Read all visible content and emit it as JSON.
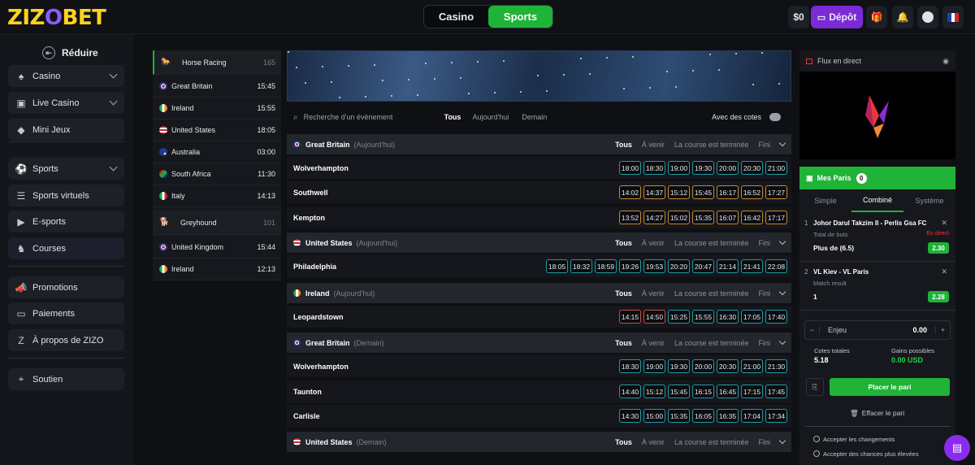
{
  "brand": {
    "logo_left": "ZIZ",
    "logo_mid": "O",
    "logo_right": "BET"
  },
  "topbar": {
    "casino": "Casino",
    "sports": "Sports",
    "balance": "$0",
    "depot": "Dépôt"
  },
  "sidebar": {
    "collapse": "Réduire",
    "items": [
      {
        "label": "Casino",
        "icon": "cards-icon"
      },
      {
        "label": "Live Casino",
        "icon": "live-icon"
      },
      {
        "label": "Mini Jeux",
        "icon": "gem-icon"
      },
      {
        "label": "Sports",
        "icon": "soccer-icon"
      },
      {
        "label": "Sports virtuels",
        "icon": "virtual-icon"
      },
      {
        "label": "E-sports",
        "icon": "play-icon"
      },
      {
        "label": "Courses",
        "icon": "horse-icon"
      },
      {
        "label": "Promotions",
        "icon": "megaphone-icon"
      },
      {
        "label": "Paiements",
        "icon": "wallet-icon"
      },
      {
        "label": "À propos de ZIZO",
        "icon": "z-icon"
      },
      {
        "label": "Soutien",
        "icon": "support-icon"
      }
    ]
  },
  "races": {
    "horse": {
      "label": "Horse Racing",
      "count": "165"
    },
    "horse_items": [
      {
        "name": "Great Britain",
        "time": "15:45",
        "flag": "gb"
      },
      {
        "name": "Ireland",
        "time": "15:55",
        "flag": "ie"
      },
      {
        "name": "United States",
        "time": "18:05",
        "flag": "us"
      },
      {
        "name": "Australia",
        "time": "03:00",
        "flag": "au"
      },
      {
        "name": "South Africa",
        "time": "11:30",
        "flag": "za"
      },
      {
        "name": "Italy",
        "time": "14:13",
        "flag": "it"
      }
    ],
    "grey": {
      "label": "Greyhound",
      "count": "101"
    },
    "grey_items": [
      {
        "name": "United Kingdom",
        "time": "15:44",
        "flag": "gb"
      },
      {
        "name": "Ireland",
        "time": "12:13",
        "flag": "ie"
      }
    ]
  },
  "filter": {
    "search_placeholder": "Recherche d'un évènement",
    "tabs": [
      "Tous",
      "Aujourd'hui",
      "Demain"
    ],
    "avec": "Avec des cotes"
  },
  "section_tabs": [
    "Tous",
    "À venir",
    "La course est terminée",
    "Fini"
  ],
  "sections": [
    {
      "title": "Great Britain",
      "sub": "(Aujourd'hui)",
      "flag": "gb",
      "rows": [
        {
          "name": "Wolverhampton",
          "style": "teal",
          "times": [
            "18:00",
            "18:30",
            "19:00",
            "19:30",
            "20:00",
            "20:30",
            "21:00"
          ]
        },
        {
          "name": "Southwell",
          "style": "orange",
          "times": [
            "14:02",
            "14:37",
            "15:12",
            "15:45",
            "16:17",
            "16:52",
            "17:27"
          ]
        },
        {
          "name": "Kempton",
          "style": "orange",
          "times": [
            "13:52",
            "14:27",
            "15:02",
            "15:35",
            "16:07",
            "16:42",
            "17:17"
          ]
        }
      ]
    },
    {
      "title": "United States",
      "sub": "(Aujourd'hui)",
      "flag": "us",
      "rows": [
        {
          "name": "Philadelphia",
          "style": "teal",
          "times": [
            "18:05",
            "18:32",
            "18:59",
            "19:26",
            "19:53",
            "20:20",
            "20:47",
            "21:14",
            "21:41",
            "22:08"
          ]
        }
      ]
    },
    {
      "title": "Ireland",
      "sub": "(Aujourd'hui)",
      "flag": "ie",
      "rows": [
        {
          "name": "Leopardstown",
          "style": "mixed",
          "times": [
            "14:15",
            "14:50",
            "15:25",
            "15:55",
            "16:30",
            "17:05",
            "17:40"
          ]
        }
      ]
    },
    {
      "title": "Great Britain",
      "sub": "(Demain)",
      "flag": "gb",
      "rows": [
        {
          "name": "Wolverhampton",
          "style": "teal",
          "times": [
            "18:30",
            "19:00",
            "19:30",
            "20:00",
            "20:30",
            "21:00",
            "21:30"
          ]
        },
        {
          "name": "Taunton",
          "style": "teal",
          "times": [
            "14:40",
            "15:12",
            "15:45",
            "16:15",
            "16:45",
            "17:15",
            "17:45"
          ]
        },
        {
          "name": "Carlisle",
          "style": "teal",
          "times": [
            "14:30",
            "15:00",
            "15:35",
            "16:05",
            "16:35",
            "17:04",
            "17:34"
          ]
        }
      ]
    },
    {
      "title": "United States",
      "sub": "(Demain)",
      "flag": "us",
      "rows": []
    }
  ],
  "live": {
    "title": "Flux en direct"
  },
  "betslip": {
    "title": "Mes Paris",
    "count": "0",
    "tabs": [
      "Simple",
      "Combiné",
      "Système"
    ],
    "bets": [
      {
        "n": "1",
        "match": "Johor Darul Takzim II - Perlis Gsa FC",
        "type": "Total de buts",
        "pick": "Plus de (6.5)",
        "odds": "2.30",
        "live": "En direct"
      },
      {
        "n": "2",
        "match": "VL Kiev - VL Paris",
        "type": "Match result",
        "pick": "1",
        "odds": "2.28"
      }
    ],
    "stake_label": "Enjeu",
    "stake_value": "0.00",
    "total_odds_label": "Cotes totales",
    "total_odds": "5.18",
    "gains_label": "Gains possibles",
    "gains": "0.00 USD",
    "place": "Placer le pari",
    "clear": "Effacer le pari",
    "accept1": "Accepter les changements",
    "accept2": "Accepter des chances plus élevées"
  }
}
